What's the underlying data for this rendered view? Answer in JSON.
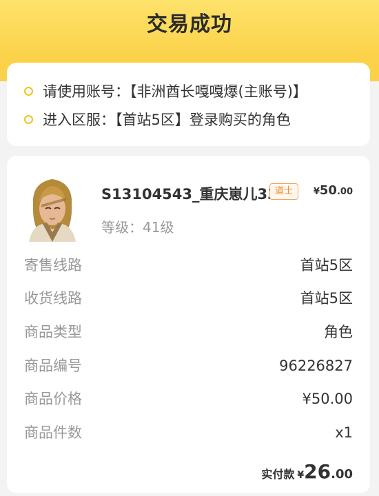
{
  "status_title": "交易成功",
  "tips": [
    "请使用账号：【非洲酋长嘎嘎爆(主账号)】",
    "进入区服：【首站5区】登录购买的角色"
  ],
  "product": {
    "name": "S13104543_重庆崽儿33",
    "class_badge": "道士",
    "price_symbol": "¥",
    "price_integer": "50",
    "price_decimal": ".00",
    "level_text": "等级：41级"
  },
  "details": [
    {
      "label": "寄售线路",
      "value": "首站5区"
    },
    {
      "label": "收货线路",
      "value": "首站5区"
    },
    {
      "label": "商品类型",
      "value": "角色"
    },
    {
      "label": "商品编号",
      "value": "96226827"
    },
    {
      "label": "商品价格",
      "value": "¥50.00"
    },
    {
      "label": "商品件数",
      "value": "x1"
    }
  ],
  "paid": {
    "label": "实付款",
    "symbol": "¥",
    "integer": "26",
    "decimal": ".00"
  },
  "colors": {
    "header_yellow": "#fcd24a",
    "dot_yellow": "#f2c21b",
    "badge_orange": "#f0882a"
  }
}
